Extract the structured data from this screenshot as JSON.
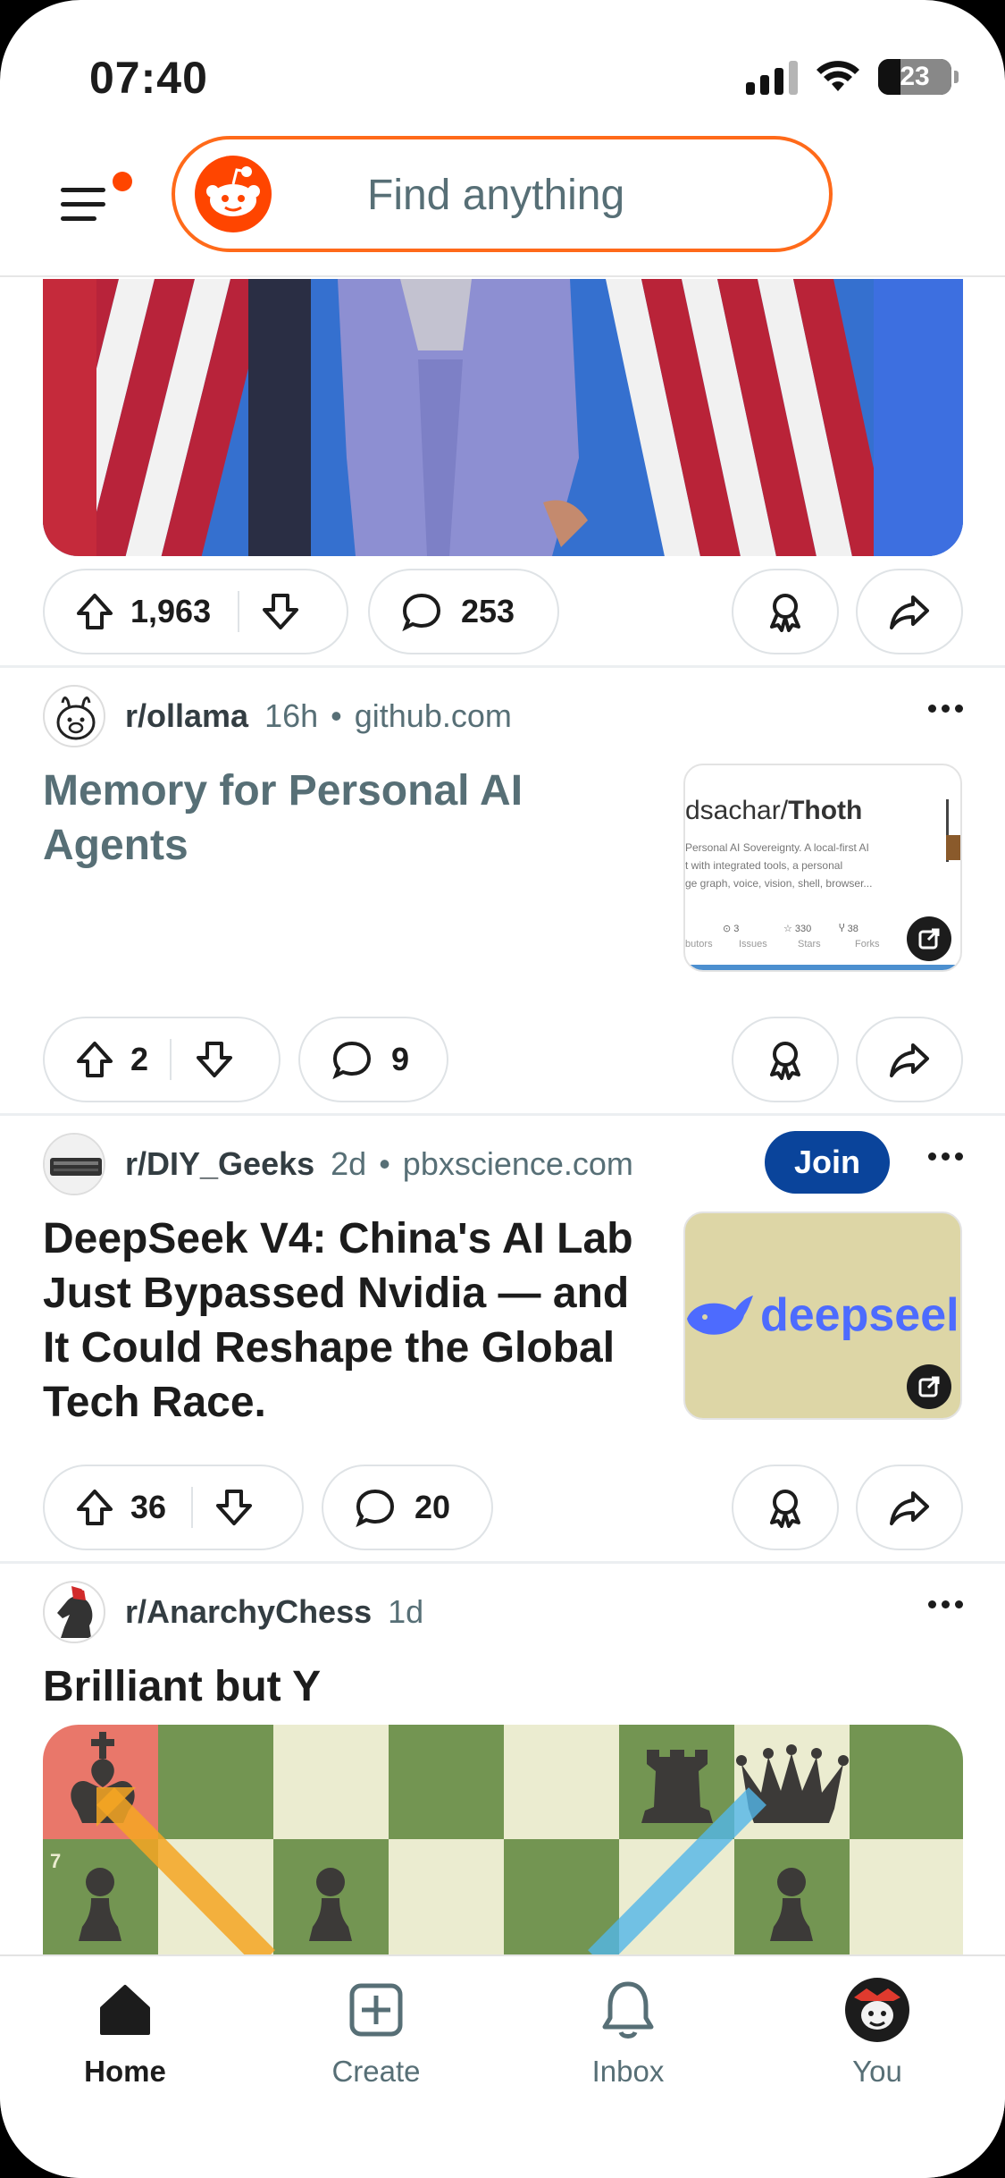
{
  "status": {
    "time": "07:40",
    "battery": "23",
    "battery_level_percent": 23
  },
  "header": {
    "search_placeholder": "Find anything",
    "menu_icon": "hamburger-menu-icon",
    "logo_icon": "reddit-snoo-icon",
    "notification_dot_color": "#ff4500"
  },
  "top_post": {
    "upvotes": "1,963",
    "comments": "253"
  },
  "posts": [
    {
      "subreddit": "r/ollama",
      "age": "16h",
      "domain": "github.com",
      "title_line1": "Memory for Personal AI",
      "title_line2": "Agents",
      "title_color": "#576f76",
      "thumb": {
        "heading_prefix": "dsachar/",
        "heading_bold": "Thoth",
        "desc1": "Personal AI Sovereignty. A local-first AI",
        "desc2": "t with integrated tools, a personal",
        "desc3": "ge graph, voice, vision, shell, browser...",
        "stat1": "3",
        "stat2": "330",
        "stat3": "38",
        "lbl0": "butors",
        "lbl1": "Issues",
        "lbl2": "Stars",
        "lbl3": "Forks"
      },
      "upvotes": "2",
      "comments": "9"
    },
    {
      "subreddit": "r/DIY_Geeks",
      "age": "2d",
      "domain": "pbxscience.com",
      "join_label": "Join",
      "title_line1": "DeepSeek V4: China's AI Lab",
      "title_line2": "Just Bypassed Nvidia — and",
      "title_line3": "It Could Reshape the Global",
      "title_line4": "Tech Race.",
      "thumb": {
        "brand": "deepseel",
        "bg": "#ddd6a6",
        "brand_color": "#4d6bfe"
      },
      "upvotes": "36",
      "comments": "20"
    },
    {
      "subreddit": "r/AnarchyChess",
      "age": "1d",
      "title": "Brilliant but Y",
      "board_rank_label": "7"
    }
  ],
  "nav": {
    "home": "Home",
    "create": "Create",
    "inbox": "Inbox",
    "you": "You"
  },
  "colors": {
    "accent": "#ff4500",
    "join": "#0a449b",
    "board_dark": "#739552",
    "board_light": "#ebecd0"
  }
}
